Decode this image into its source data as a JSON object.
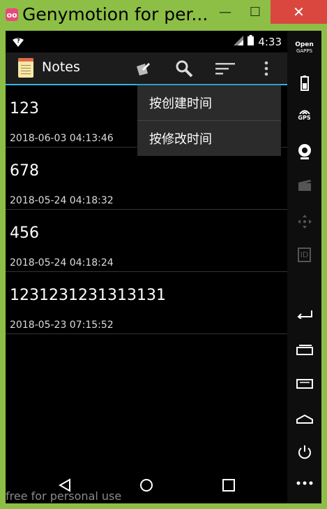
{
  "window": {
    "title": "Genymotion for per...",
    "minimize": "—",
    "maximize": "☐",
    "close": "✕"
  },
  "status": {
    "time": "4:33",
    "wifi_badge": "?"
  },
  "appbar": {
    "title": "Notes",
    "icons": [
      "new-note-icon",
      "search-icon",
      "sort-icon",
      "overflow-menu-icon"
    ]
  },
  "notes": [
    {
      "title": "123",
      "date": "2018-06-03 04:13:46"
    },
    {
      "title": "678",
      "date": "2018-05-24 04:18:32"
    },
    {
      "title": "456",
      "date": "2018-05-24 04:18:24"
    },
    {
      "title": "1231231231313131",
      "date": "2018-05-23 07:15:52"
    }
  ],
  "sort_menu": {
    "items": [
      "按创建时间",
      "按修改时间"
    ]
  },
  "watermark": "free for personal use",
  "sidebar": {
    "opengapps_top": "Open",
    "opengapps_bottom": "GAPPS",
    "gps": "GPS",
    "id": "ID"
  }
}
